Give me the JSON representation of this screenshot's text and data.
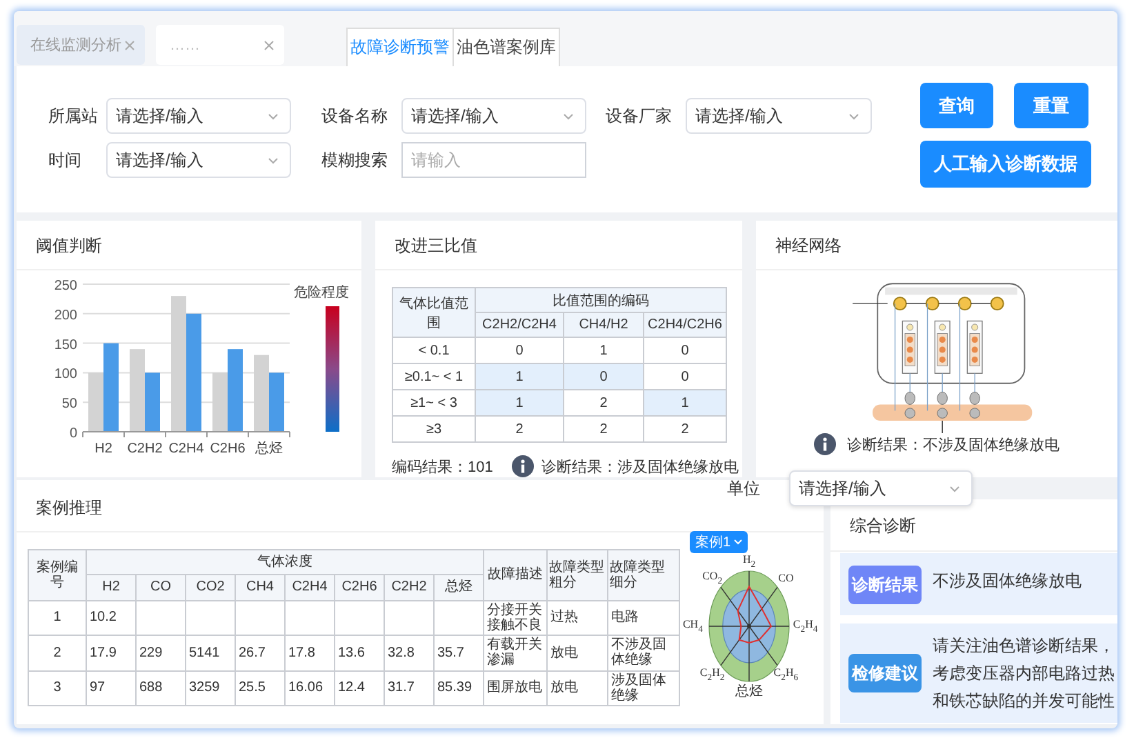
{
  "tabs": [
    {
      "label": "在线监测分析",
      "selected": false
    },
    {
      "label": "……",
      "selected": true
    }
  ],
  "view_tabs": [
    {
      "label": "故障诊断预警",
      "selected": true
    },
    {
      "label": "油色谱案例库",
      "selected": false
    }
  ],
  "filters": [
    {
      "label": "所属站",
      "kind": "select",
      "placeholder": "请选择/输入"
    },
    {
      "label": "设备名称",
      "kind": "select",
      "placeholder": "请选择/输入"
    },
    {
      "label": "设备厂家",
      "kind": "select",
      "placeholder": "请选择/输入"
    },
    {
      "label": "时间",
      "kind": "select",
      "placeholder": "请选择/输入"
    },
    {
      "label": "模糊搜索",
      "kind": "input",
      "placeholder": "请输入"
    }
  ],
  "buttons": [
    {
      "label": "查询",
      "kind": "small"
    },
    {
      "label": "重置",
      "kind": "small"
    },
    {
      "label": "人工输入诊断数据",
      "kind": "wide"
    }
  ],
  "threshold": {
    "title": "阈值判断",
    "legend_label": "危险程度",
    "chart_data": {
      "type": "bar",
      "categories": [
        "H2",
        "C2H2",
        "C2H4",
        "C2H6",
        "总烃"
      ],
      "series": [
        {
          "color": "#d3d3d3",
          "values": [
            100,
            140,
            230,
            100,
            130
          ]
        },
        {
          "color": "#4a9be8",
          "values": [
            150,
            100,
            200,
            140,
            100
          ]
        }
      ],
      "grid": true,
      "ylim": [
        0,
        250
      ],
      "yticks": [
        0,
        50,
        100,
        150,
        200,
        250
      ]
    }
  },
  "ratio": {
    "title": "改进三比值",
    "range_header": "气体比值范围",
    "group_header": "比值范围的编码",
    "code_columns": [
      "C2H2/C2H4",
      "CH4/H2",
      "C2H4/C2H6"
    ],
    "rows": [
      {
        "range": "< 0.1",
        "codes": [
          "0",
          "1",
          "0"
        ],
        "highlighted": [
          false,
          false,
          false
        ]
      },
      {
        "range": "≥0.1~ < 1",
        "codes": [
          "1",
          "0",
          "0"
        ],
        "highlighted": [
          true,
          true,
          false
        ]
      },
      {
        "range": "≥1~ < 3",
        "codes": [
          "1",
          "2",
          "1"
        ],
        "highlighted": [
          true,
          false,
          true
        ]
      },
      {
        "range": "≥3",
        "codes": [
          "2",
          "2",
          "2"
        ],
        "highlighted": [
          false,
          false,
          false
        ]
      }
    ],
    "code_result": "编码结果：101",
    "diagnosis": "诊断结果：涉及固体绝缘放电"
  },
  "neural": {
    "title": "神经网络",
    "diagnosis": "诊断结果：不涉及固体绝缘放电"
  },
  "cases": {
    "title": "案例推理",
    "unit": {
      "label": "单位",
      "placeholder": "请选择/输入"
    },
    "table": {
      "id_header": "案例编号",
      "gas_header": "气体浓度",
      "gas_columns": [
        "H2",
        "CO",
        "CO2",
        "CH4",
        "C2H4",
        "C2H6",
        "C2H2",
        "总烃"
      ],
      "extra_headers": [
        "故障描述",
        "故障类型粗分",
        "故障类型细分"
      ],
      "rows": [
        {
          "id": "1",
          "gases": [
            "10.2"
          ],
          "description": "分接开关接触不良",
          "coarse_type": "过热",
          "fine_type": "电路"
        },
        {
          "id": "2",
          "gases": [
            "17.9",
            "229",
            "5141",
            "26.7",
            "17.8",
            "13.6",
            "32.8",
            "35.7"
          ],
          "description": "有载开关渗漏",
          "coarse_type": "放电",
          "fine_type": "不涉及固体绝缘"
        },
        {
          "id": "3",
          "gases": [
            "97",
            "688",
            "3259",
            "25.5",
            "16.06",
            "12.4",
            "31.7",
            "85.39"
          ],
          "description": "围屏放电",
          "coarse_type": "放电",
          "fine_type": "涉及固体绝缘"
        }
      ]
    },
    "radar": {
      "selector": "案例1",
      "axes": [
        "H$_{2}$",
        "CO",
        "C$_{2}$H$_{4}$",
        "C$_{2}$H$_{6}$",
        "总烃",
        "C$_{2}$H$_{2}$",
        "CH$_{4}$",
        "CO$_{2}$"
      ]
    }
  },
  "summary": {
    "title": "综合诊断",
    "items": [
      {
        "kind": "result",
        "label": "诊断结果",
        "color": "#6f86f7",
        "text": "不涉及固体绝缘放电"
      },
      {
        "kind": "advice",
        "label": "检修建议",
        "color": "#3a94e6",
        "text": "请关注油色谱诊断结果，考虑变压器内部电路过热和铁芯缺陷的并发可能性"
      }
    ]
  }
}
